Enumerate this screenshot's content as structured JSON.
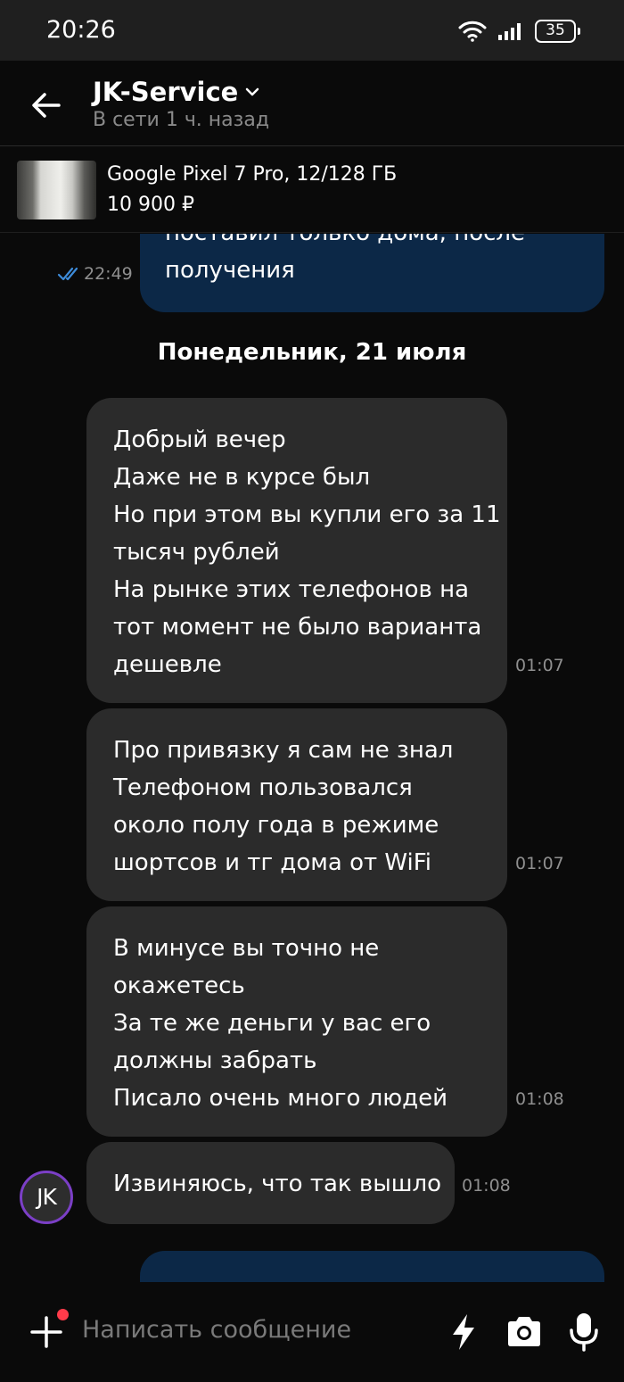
{
  "status_bar": {
    "time": "20:26",
    "battery": "35"
  },
  "header": {
    "title": "JK-Service",
    "subtitle": "В сети 1 ч. назад"
  },
  "product": {
    "name": "Google Pixel 7 Pro, 12/128 ГБ",
    "price": "10 900 ₽"
  },
  "messages": {
    "outgoing_1": {
      "lines": [
        "поставил только дома, после",
        "получения"
      ],
      "time": "22:49"
    },
    "date_separator": "Понедельник, 21 июля",
    "incoming": [
      {
        "lines": [
          "Добрый вечер",
          "Даже не в курсе был",
          "Но при этом вы купли его за 11",
          "тысяч рублей",
          "На рынке этих телефонов на",
          "тот момент не было варианта",
          "дешевле"
        ],
        "time": "01:07"
      },
      {
        "lines": [
          "Про привязку я сам не знал",
          "Телефоном пользовался",
          "около полу года в режиме",
          "шортсов и тг дома от WiFi"
        ],
        "time": "01:07"
      },
      {
        "lines": [
          "В минусе вы точно не",
          "окажетесь",
          "За те же деньги у вас его",
          "должны забрать",
          "Писало очень много людей"
        ],
        "time": "01:08"
      },
      {
        "lines": [
          "Извиняюсь, что так вышло"
        ],
        "time": "01:08"
      }
    ],
    "avatar_initials": "JK"
  },
  "composer": {
    "placeholder": "Написать сообщение"
  },
  "colors": {
    "outgoing_bubble": "#0c2847",
    "incoming_bubble": "#2b2b2b",
    "avatar_ring": "#7b3fc6",
    "notification_dot": "#ff3b4a",
    "read_check": "#3d8bd9"
  }
}
